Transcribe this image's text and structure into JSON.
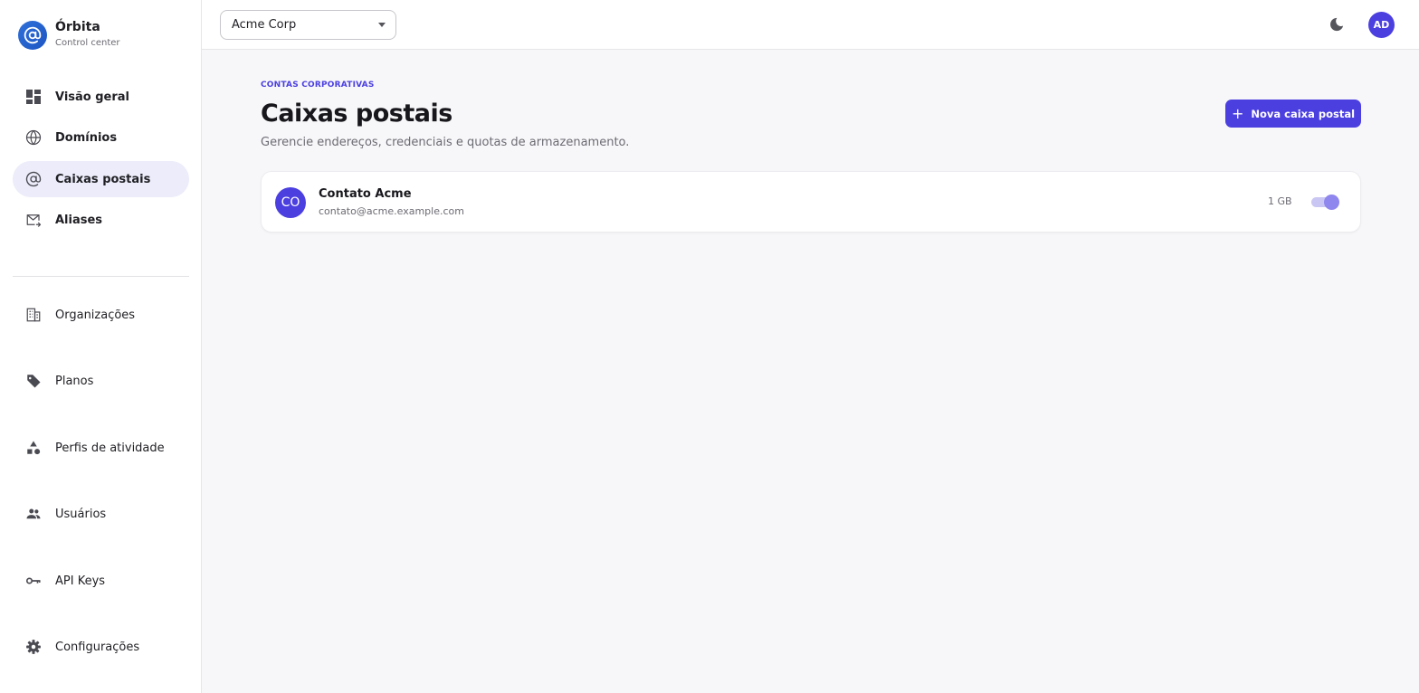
{
  "brand": {
    "title": "Órbita",
    "subtitle": "Control center"
  },
  "sidebar": {
    "primary": [
      {
        "label": "Visão geral",
        "icon": "dashboard-icon"
      },
      {
        "label": "Domínios",
        "icon": "globe-icon"
      },
      {
        "label": "Caixas postais",
        "icon": "at-sign-icon",
        "active": true
      },
      {
        "label": "Aliases",
        "icon": "mail-forward-icon"
      }
    ],
    "secondary": [
      {
        "label": "Organizações",
        "icon": "building-icon"
      },
      {
        "label": "Planos",
        "icon": "tag-icon"
      },
      {
        "label": "Perfis de atividade",
        "icon": "shapes-icon"
      },
      {
        "label": "Usuários",
        "icon": "users-icon"
      },
      {
        "label": "API Keys",
        "icon": "key-icon"
      },
      {
        "label": "Configurações",
        "icon": "gear-icon"
      }
    ]
  },
  "topbar": {
    "org_selected": "Acme Corp",
    "theme_icon": "moon-icon",
    "user_initials": "AD"
  },
  "page": {
    "eyebrow": "CONTAS CORPORATIVAS",
    "title": "Caixas postais",
    "subtitle": "Gerencie endereços, credenciais e quotas de armazenamento.",
    "new_button": {
      "plus": "+",
      "label": "Nova caixa postal"
    }
  },
  "mailboxes": [
    {
      "initials": "CO",
      "name": "Contato Acme",
      "email": "contato@acme.example.com",
      "quota": "1 GB",
      "enabled": true
    }
  ],
  "colors": {
    "accent": "#4b3fe0",
    "active_nav_bg": "#ececfa",
    "brand_logo": "#2f6fd8"
  }
}
